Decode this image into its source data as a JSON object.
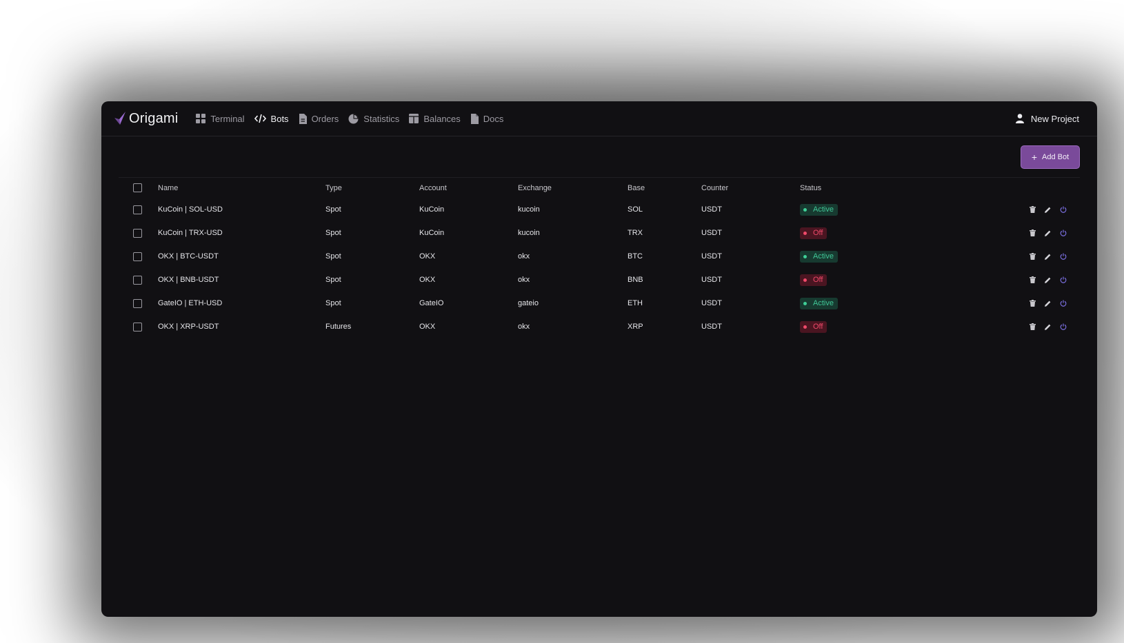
{
  "brand": {
    "name": "Origami"
  },
  "nav": [
    {
      "label": "Terminal",
      "icon": "grid-icon",
      "active": false
    },
    {
      "label": "Bots",
      "icon": "code-icon",
      "active": true
    },
    {
      "label": "Orders",
      "icon": "document-icon",
      "active": false
    },
    {
      "label": "Statistics",
      "icon": "pie-chart-icon",
      "active": false
    },
    {
      "label": "Balances",
      "icon": "table-icon",
      "active": false
    },
    {
      "label": "Docs",
      "icon": "file-icon",
      "active": false
    }
  ],
  "user": {
    "label": "New Project",
    "icon": "user-icon"
  },
  "toolbar": {
    "add_label": "Add Bot"
  },
  "table": {
    "columns": [
      "Name",
      "Type",
      "Account",
      "Exchange",
      "Base",
      "Counter",
      "Status"
    ],
    "rows": [
      {
        "name": "KuCoin | SOL-USD",
        "type": "Spot",
        "account": "KuCoin",
        "exchange": "kucoin",
        "base": "SOL",
        "counter": "USDT",
        "status": "Active"
      },
      {
        "name": "KuCoin | TRX-USD",
        "type": "Spot",
        "account": "KuCoin",
        "exchange": "kucoin",
        "base": "TRX",
        "counter": "USDT",
        "status": "Off"
      },
      {
        "name": "OKX | BTC-USDT",
        "type": "Spot",
        "account": "OKX",
        "exchange": "okx",
        "base": "BTC",
        "counter": "USDT",
        "status": "Active"
      },
      {
        "name": "OKX | BNB-USDT",
        "type": "Spot",
        "account": "OKX",
        "exchange": "okx",
        "base": "BNB",
        "counter": "USDT",
        "status": "Off"
      },
      {
        "name": "GateIO | ETH-USD",
        "type": "Spot",
        "account": "GateIO",
        "exchange": "gateio",
        "base": "ETH",
        "counter": "USDT",
        "status": "Active"
      },
      {
        "name": "OKX | XRP-USDT",
        "type": "Futures",
        "account": "OKX",
        "exchange": "okx",
        "base": "XRP",
        "counter": "USDT",
        "status": "Off"
      }
    ],
    "row_actions": [
      "trash-icon",
      "pencil-icon",
      "power-icon"
    ]
  },
  "colors": {
    "background": "#111013",
    "accent": "#7a4a9a",
    "active": "#3fcf97",
    "off": "#f04a6a",
    "power_icon": "#7b6fe0"
  }
}
